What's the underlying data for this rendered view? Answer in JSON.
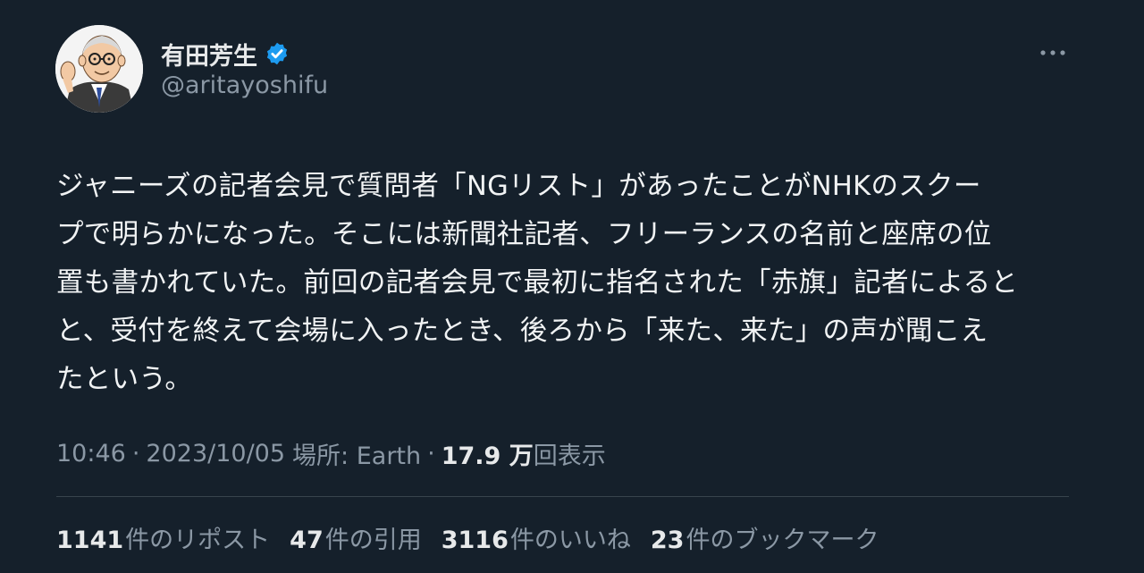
{
  "author": {
    "display_name": "有田芳生",
    "handle": "@aritayoshifu",
    "verified": true,
    "avatar_icon": "caricature-avatar"
  },
  "tweet": {
    "lines": [
      "ジャニーズの記者会見で質問者「NGリスト」があったことがNHKのスクー",
      "プで明らかになった。そこには新聞社記者、フリーランスの名前と座席の位",
      "置も書かれていた。前回の記者会見で最初に指名された「赤旗」記者によると",
      "と、受付を終えて会場に入ったとき、後ろから「来た、来た」の声が聞こえ",
      "たという。"
    ]
  },
  "meta": {
    "time": "10:46",
    "separator": "·",
    "date": "2023/10/05",
    "location": "場所: Earth",
    "views_count": "17.9 万",
    "views_label": "回表示"
  },
  "stats": [
    {
      "count": "1141",
      "label": "件のリポスト"
    },
    {
      "count": "47",
      "label": "件の引用"
    },
    {
      "count": "3116",
      "label": "件のいいね"
    },
    {
      "count": "23",
      "label": "件のブックマーク"
    }
  ],
  "colors": {
    "background": "#15202b",
    "text": "#e7e9ea",
    "secondary": "#8b98a5",
    "verified_blue": "#1d9bf0",
    "divider": "#38444d"
  }
}
